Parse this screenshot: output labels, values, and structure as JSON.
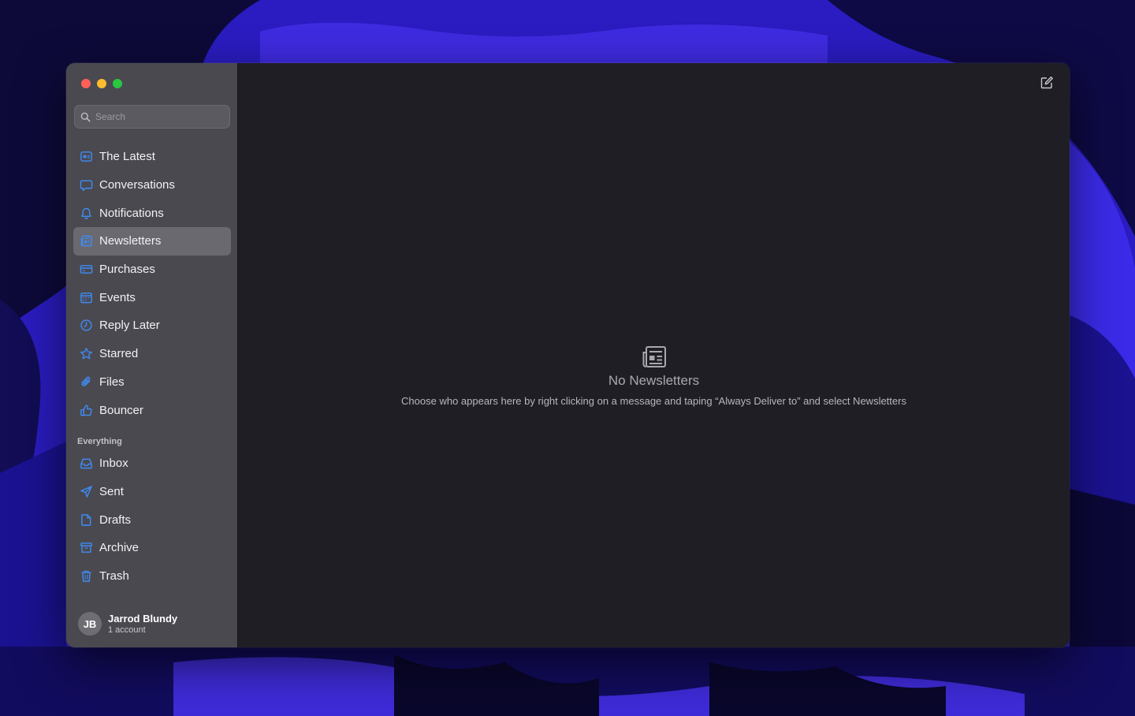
{
  "colors": {
    "accent": "#3f8cf5",
    "sidebar_bg": "#4a4950",
    "main_bg": "#1f1e25",
    "selected_bg": "#6a6970",
    "wallpaper": "#2b1bc4"
  },
  "window": {
    "traffic_lights": [
      "close",
      "minimize",
      "maximize"
    ]
  },
  "search": {
    "placeholder": "Search",
    "value": ""
  },
  "sidebar": {
    "items": [
      {
        "label": "The Latest",
        "icon": "latest-icon",
        "selected": false
      },
      {
        "label": "Conversations",
        "icon": "chat-bubble-icon",
        "selected": false
      },
      {
        "label": "Notifications",
        "icon": "bell-icon",
        "selected": false
      },
      {
        "label": "Newsletters",
        "icon": "newspaper-icon",
        "selected": true
      },
      {
        "label": "Purchases",
        "icon": "credit-card-icon",
        "selected": false
      },
      {
        "label": "Events",
        "icon": "calendar-icon",
        "selected": false
      },
      {
        "label": "Reply Later",
        "icon": "clock-icon",
        "selected": false
      },
      {
        "label": "Starred",
        "icon": "star-icon",
        "selected": false
      },
      {
        "label": "Files",
        "icon": "paperclip-icon",
        "selected": false
      },
      {
        "label": "Bouncer",
        "icon": "thumbs-up-icon",
        "selected": false
      }
    ],
    "section_title": "Everything",
    "everything": [
      {
        "label": "Inbox",
        "icon": "inbox-icon"
      },
      {
        "label": "Sent",
        "icon": "paper-plane-icon"
      },
      {
        "label": "Drafts",
        "icon": "document-icon"
      },
      {
        "label": "Archive",
        "icon": "archive-box-icon"
      },
      {
        "label": "Trash",
        "icon": "trash-icon"
      }
    ]
  },
  "account": {
    "initials": "JB",
    "name": "Jarrod Blundy",
    "subtitle": "1 account"
  },
  "main": {
    "compose_icon": "compose-icon",
    "empty_icon": "newspaper-icon",
    "empty_title": "No Newsletters",
    "empty_description": "Choose who appears here by right clicking on a message and taping “Always Deliver to” and select Newsletters"
  }
}
